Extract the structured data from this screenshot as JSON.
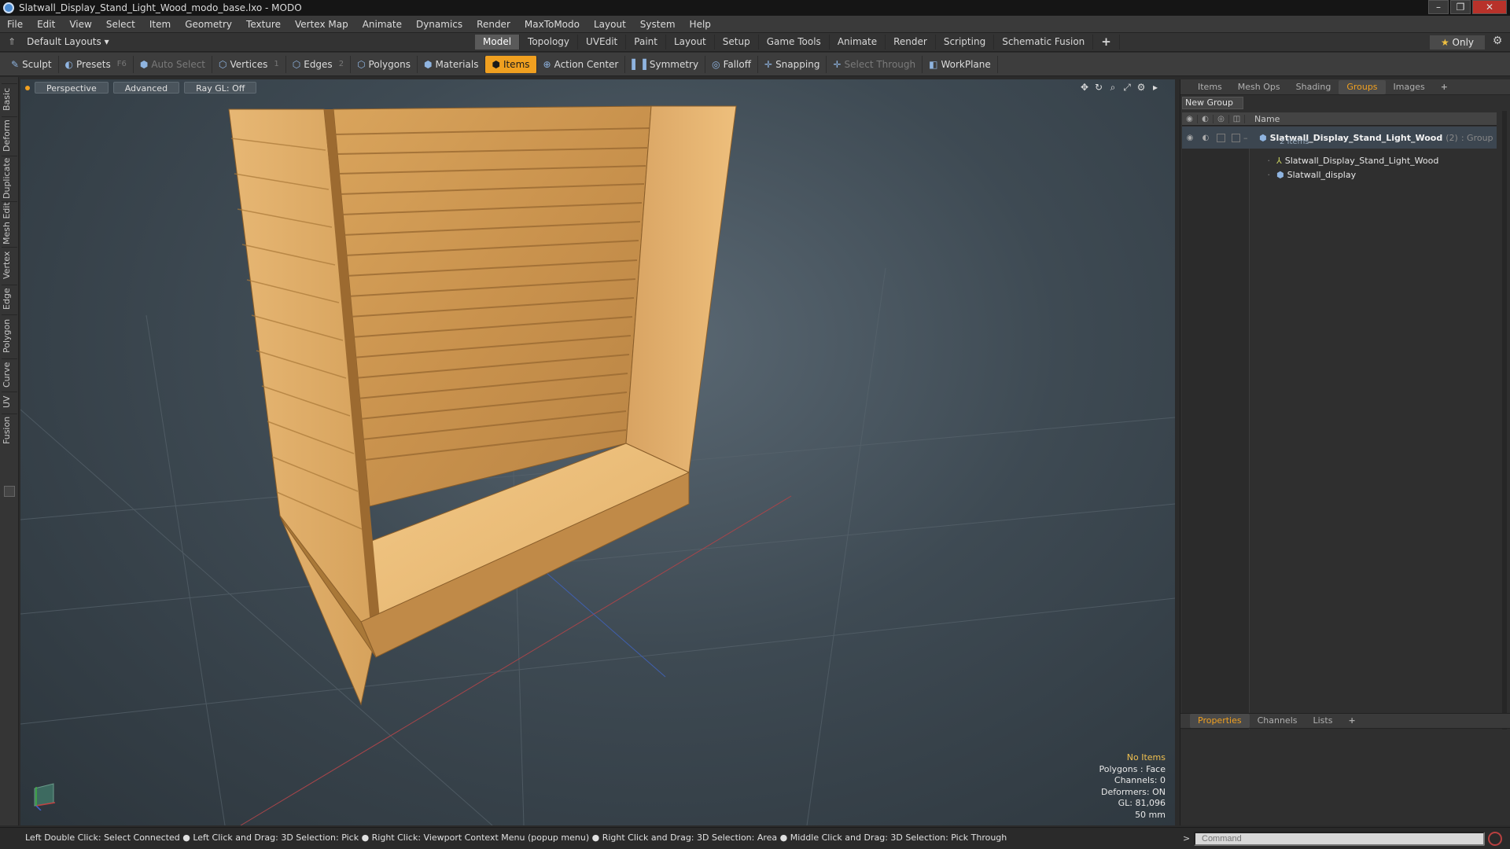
{
  "window": {
    "title": "Slatwall_Display_Stand_Light_Wood_modo_base.lxo - MODO",
    "controls": [
      "minimize",
      "maximize",
      "close"
    ]
  },
  "menu": [
    "File",
    "Edit",
    "View",
    "Select",
    "Item",
    "Geometry",
    "Texture",
    "Vertex Map",
    "Animate",
    "Dynamics",
    "Render",
    "MaxToModo",
    "Layout",
    "System",
    "Help"
  ],
  "layout_selector": "Default Layouts",
  "mode_tabs": [
    "Model",
    "Topology",
    "UVEdit",
    "Paint",
    "Layout",
    "Setup",
    "Game Tools",
    "Animate",
    "Render",
    "Scripting",
    "Schematic Fusion",
    "+"
  ],
  "only_button": "Only",
  "toolbar": {
    "sculpt": "Sculpt",
    "presets": "Presets",
    "presets_key": "F6",
    "auto_select": "Auto Select",
    "vertices": "Vertices",
    "vertices_key": "1",
    "edges": "Edges",
    "edges_key": "2",
    "polygons": "Polygons",
    "materials": "Materials",
    "items": "Items",
    "action_center": "Action Center",
    "symmetry": "Symmetry",
    "falloff": "Falloff",
    "snapping": "Snapping",
    "select_through": "Select Through",
    "workplane": "WorkPlane"
  },
  "left_tabs": [
    "Basic",
    "Deform",
    "Duplicate",
    "Mesh Edit",
    "Vertex",
    "Edge",
    "Polygon",
    "Curve",
    "UV",
    "Fusion"
  ],
  "viewport": {
    "view": "Perspective",
    "shading": "Advanced",
    "raygl": "Ray GL: Off",
    "info": {
      "selection": "No Items",
      "polygons": "Polygons : Face",
      "channels": "Channels: 0",
      "deformers": "Deformers: ON",
      "gl": "GL: 81,096",
      "unit": "50 mm"
    }
  },
  "right_panel": {
    "tabs": [
      "Items",
      "Mesh Ops",
      "Shading",
      "Groups",
      "Images",
      "+"
    ],
    "active_tab": "Groups",
    "new_group": "New Group",
    "column_name": "Name",
    "group": {
      "name": "Slatwall_Display_Stand_Light_Wood",
      "count": "(2)",
      "type": ": Group",
      "subtitle": "2 Items"
    },
    "children": [
      "Slatwall_Display_Stand_Light_Wood",
      "Slatwall_display"
    ]
  },
  "properties_panel": {
    "tabs": [
      "Properties",
      "Channels",
      "Lists",
      "+"
    ],
    "active_tab": "Properties"
  },
  "status": {
    "hints": "Left Double Click: Select Connected ● Left Click and Drag: 3D Selection: Pick ● Right Click: Viewport Context Menu (popup menu) ● Right Click and Drag: 3D Selection: Area ● Middle Click and Drag: 3D Selection: Pick Through",
    "command_placeholder": "Command"
  },
  "colors": {
    "accent": "#f0a020",
    "wood_light": "#e2b06a",
    "wood_dark": "#b07a3a",
    "viewport_bg": "#3e4a53"
  }
}
